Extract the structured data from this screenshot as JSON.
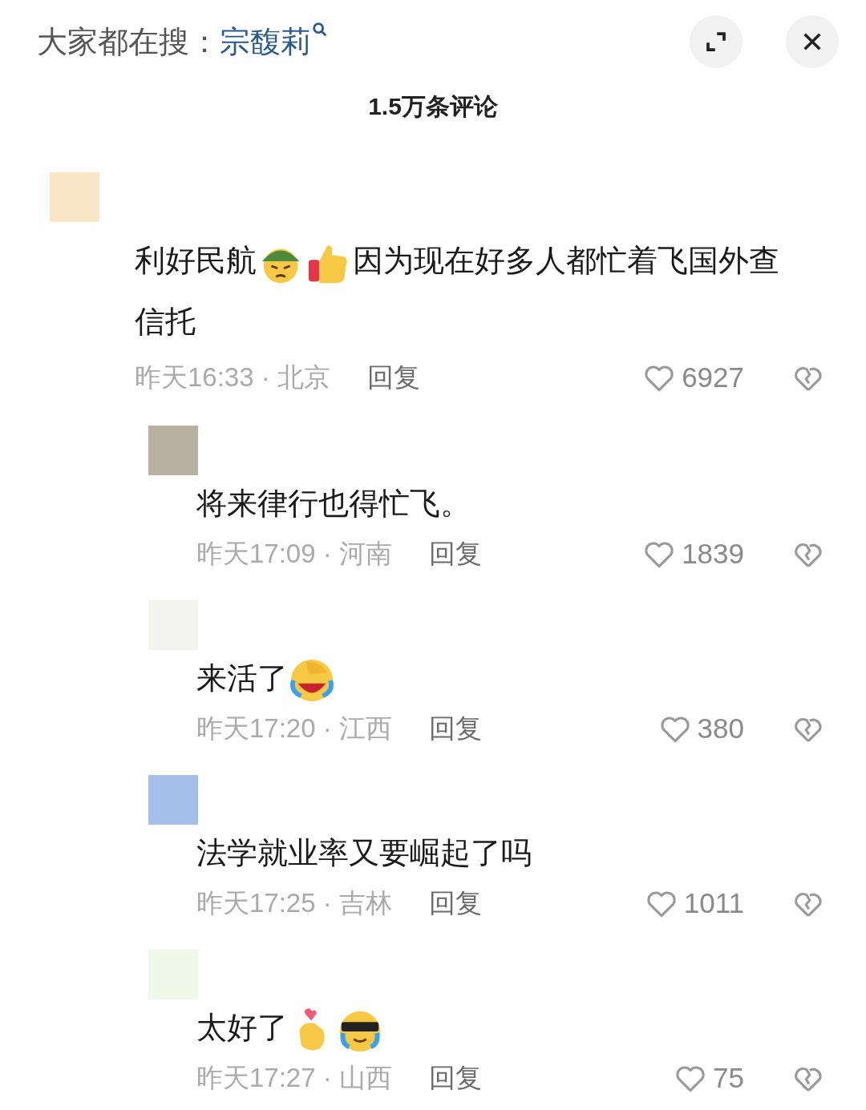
{
  "header": {
    "label": "大家都在搜：",
    "search_term": "宗馥莉"
  },
  "title": "1.5万条评论",
  "comments": [
    {
      "kind": "top",
      "content": [
        {
          "kind": "text",
          "text": "利好民航"
        },
        {
          "kind": "helmet"
        },
        {
          "kind": "thumbs"
        },
        {
          "kind": "text",
          "text": "因为现在好多人都忙着飞国外查"
        },
        {
          "kind": "text",
          "text": "信托"
        }
      ],
      "meta": "昨天16:33 · 北京",
      "reply": "回复",
      "likes": "6927"
    },
    {
      "kind": "reply",
      "content": [
        {
          "kind": "text",
          "text": "将来律行也得忙飞。"
        }
      ],
      "meta": "昨天17:09 · 河南",
      "reply": "回复",
      "likes": "1839"
    },
    {
      "kind": "reply",
      "content": [
        {
          "kind": "text",
          "text": "来活了"
        },
        {
          "kind": "laughcry"
        }
      ],
      "meta": "昨天17:20 · 江西",
      "reply": "回复",
      "likes": "380"
    },
    {
      "kind": "reply",
      "content": [
        {
          "kind": "text",
          "text": "法学就业率又要崛起了吗"
        }
      ],
      "meta": "昨天17:25 · 吉林",
      "reply": "回复",
      "likes": "1011"
    },
    {
      "kind": "reply",
      "content": [
        {
          "kind": "text",
          "text": "太好了"
        },
        {
          "kind": "fingerheart"
        },
        {
          "kind": "sunglasses"
        }
      ],
      "meta": "昨天17:27 · 山西",
      "reply": "回复",
      "likes": "75"
    }
  ]
}
